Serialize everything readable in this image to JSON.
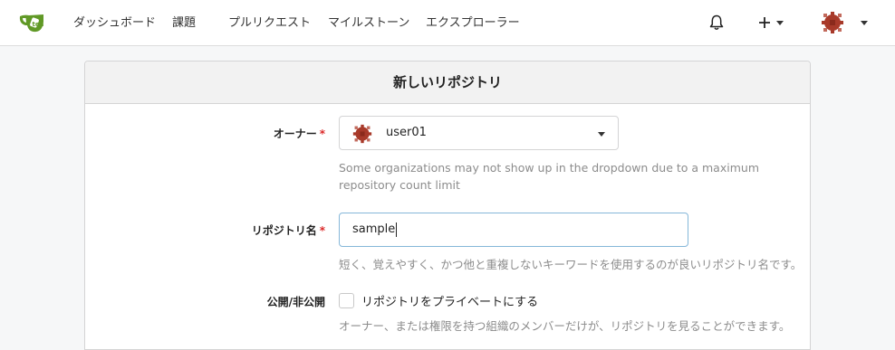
{
  "nav": {
    "items": [
      "ダッシュボード",
      "課題",
      "プルリクエスト",
      "マイルストーン",
      "エクスプローラー"
    ]
  },
  "colors": {
    "logo_green": "#609926",
    "avatar_red": "#a83a2a",
    "required_red": "#db2828",
    "focus_border": "#85b7d9"
  },
  "icons": [
    "gitea-logo-icon",
    "bell-icon",
    "plus-icon",
    "caret-down-icon",
    "avatar"
  ],
  "form": {
    "title": "新しいリポジトリ",
    "owner": {
      "label": "オーナー",
      "required": "*",
      "value": "user01",
      "help_line1": "Some organizations may not show up in the dropdown due to a maximum",
      "help_line2": "repository count limit"
    },
    "repo_name": {
      "label": "リポジトリ名",
      "required": "*",
      "value": "sample",
      "help": "短く、覚えやすく、かつ他と重複しないキーワードを使用するのが良いリポジトリ名です。"
    },
    "visibility": {
      "label": "公開/非公開",
      "checkbox_label": "リポジトリをプライベートにする",
      "checked": false,
      "help": "オーナー、または権限を持つ組織のメンバーだけが、リポジトリを見ることができます。"
    }
  }
}
